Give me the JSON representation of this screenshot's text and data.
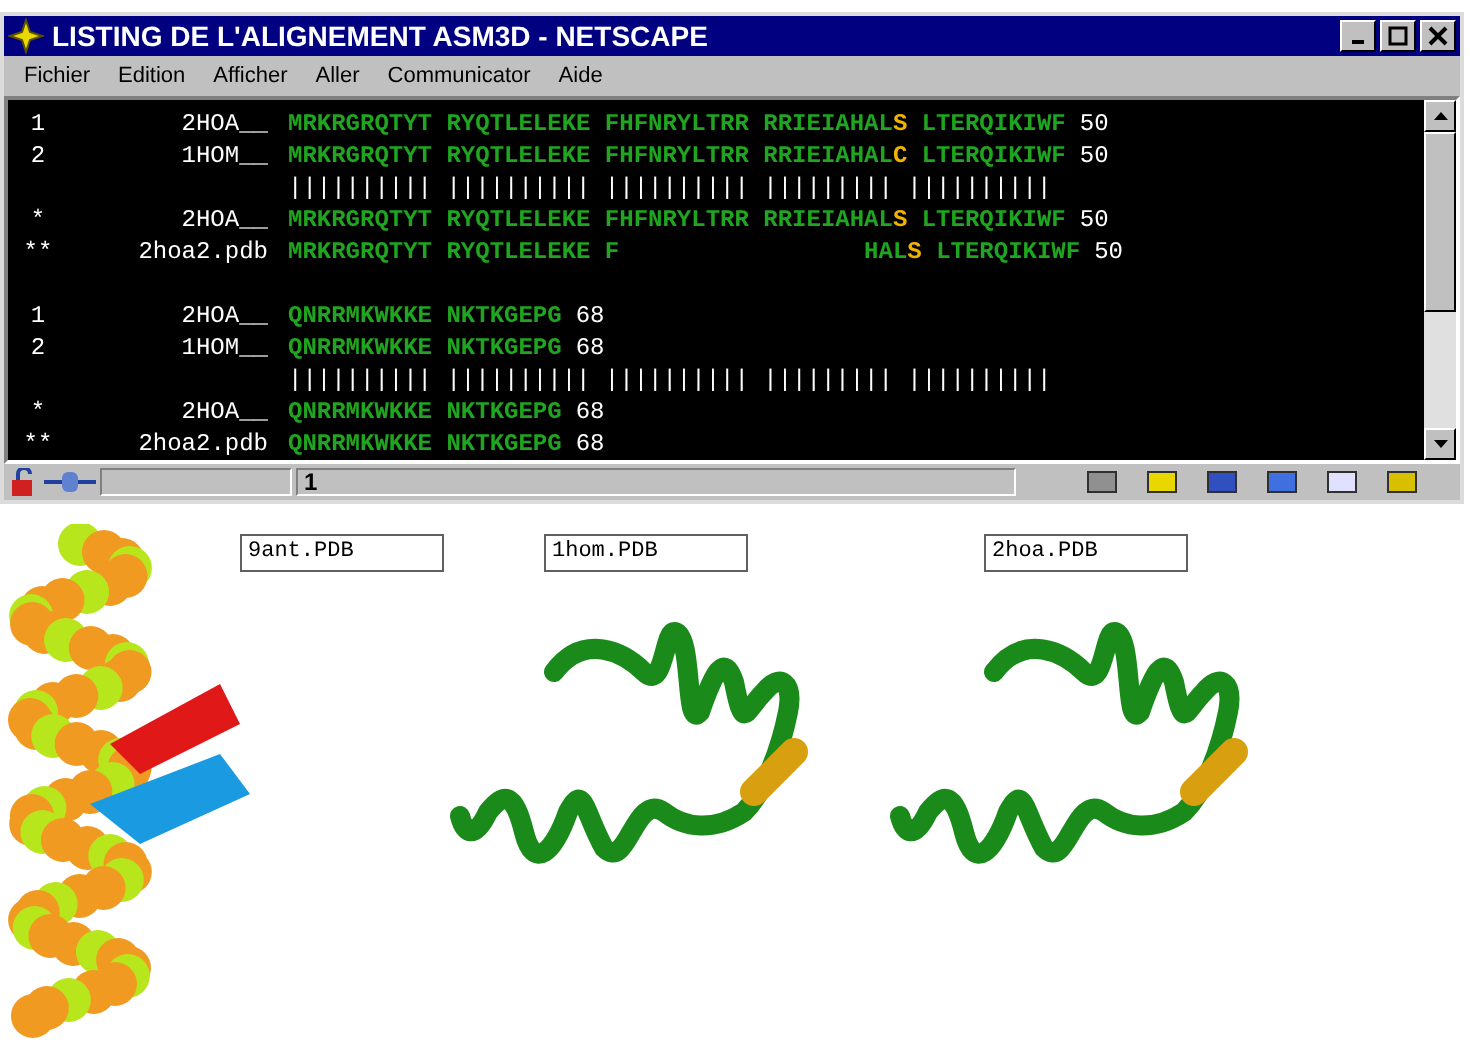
{
  "window": {
    "title": "LISTING DE L'ALIGNEMENT ASM3D - NETSCAPE"
  },
  "menu": [
    "Fichier",
    "Edition",
    "Afficher",
    "Aller",
    "Communicator",
    "Aide"
  ],
  "blocks": [
    {
      "rows": [
        {
          "kind": "seq",
          "marker": "1",
          "name": "2HOA__",
          "parts": [
            {
              "text": "MRKRGRQTYT RYQTLELEKE FHFNRYLTRR RRIEIAHAL",
              "color": "#1fa51f"
            },
            {
              "text": "S",
              "color": "#f0b400"
            },
            {
              "text": " LTERQIKIWF",
              "color": "#1fa51f"
            }
          ],
          "count": "50"
        },
        {
          "kind": "seq",
          "marker": "2",
          "name": "1HOM__",
          "parts": [
            {
              "text": "MRKRGRQTYT RYQTLELEKE FHFNRYLTRR RRIEIAHAL",
              "color": "#1fa51f"
            },
            {
              "text": "C",
              "color": "#f0b400"
            },
            {
              "text": " LTERQIKIWF",
              "color": "#1fa51f"
            }
          ],
          "count": "50"
        },
        {
          "kind": "match",
          "bars": "|||||||||| |||||||||| |||||||||| ||||||||| ||||||||||"
        },
        {
          "kind": "seq",
          "marker": "*",
          "name": "2HOA__",
          "parts": [
            {
              "text": "MRKRGRQTYT RYQTLELEKE FHFNRYLTRR RRIEIAHAL",
              "color": "#1fa51f"
            },
            {
              "text": "S",
              "color": "#f0b400"
            },
            {
              "text": " LTERQIKIWF",
              "color": "#1fa51f"
            }
          ],
          "count": "50"
        },
        {
          "kind": "seq",
          "marker": "**",
          "name": "2hoa2.pdb",
          "parts": [
            {
              "text": "MRKRGRQTYT RYQTLELEKE F",
              "color": "#1fa51f"
            },
            {
              "text": "                 HAL",
              "color": "#1fa51f"
            },
            {
              "text": "S",
              "color": "#f0b400"
            },
            {
              "text": " LTERQIKIWF",
              "color": "#1fa51f"
            }
          ],
          "count": "50"
        }
      ]
    },
    {
      "rows": [
        {
          "kind": "seq",
          "marker": "1",
          "name": "2HOA__",
          "parts": [
            {
              "text": "QNRRMKWKKE NKTKGEPG",
              "color": "#1fa51f"
            }
          ],
          "count": "68"
        },
        {
          "kind": "seq",
          "marker": "2",
          "name": "1HOM__",
          "parts": [
            {
              "text": "QNRRMKWKKE NKTKGEPG",
              "color": "#1fa51f"
            }
          ],
          "count": "68"
        },
        {
          "kind": "match",
          "bars": "|||||||||| |||||||||| |||||||||| ||||||||| ||||||||||"
        },
        {
          "kind": "seq",
          "marker": "*",
          "name": "2HOA__",
          "parts": [
            {
              "text": "QNRRMKWKKE NKTKGEPG",
              "color": "#1fa51f"
            }
          ],
          "count": "68"
        },
        {
          "kind": "seq",
          "marker": "**",
          "name": "2hoa2.pdb",
          "parts": [
            {
              "text": "QNRRMKWKKE NKTKGEPG",
              "color": "#1fa51f"
            }
          ],
          "count": "68"
        }
      ]
    }
  ],
  "status_bar": {
    "field": "1"
  },
  "structures": [
    {
      "kind": "spacefill",
      "label": "9ant.PDB"
    },
    {
      "kind": "tube",
      "label": "1hom.PDB"
    },
    {
      "kind": "tube",
      "label": "2hoa.PDB"
    }
  ]
}
